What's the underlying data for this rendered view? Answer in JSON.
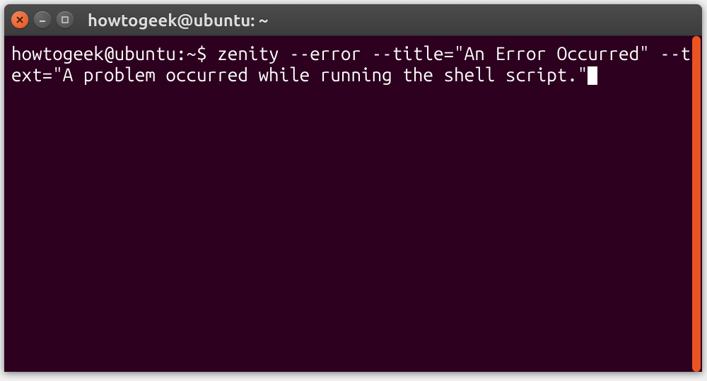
{
  "window": {
    "title": "howtogeek@ubuntu: ~"
  },
  "terminal": {
    "prompt": "howtogeek@ubuntu:~$",
    "command": "zenity --error --title=\"An Error Occurred\" --text=\"A problem occurred while running the shell script.\""
  },
  "colors": {
    "titlebar_bg": "#3c3c3c",
    "terminal_bg": "#2c001e",
    "text": "#ffffff",
    "accent": "#e95420"
  }
}
